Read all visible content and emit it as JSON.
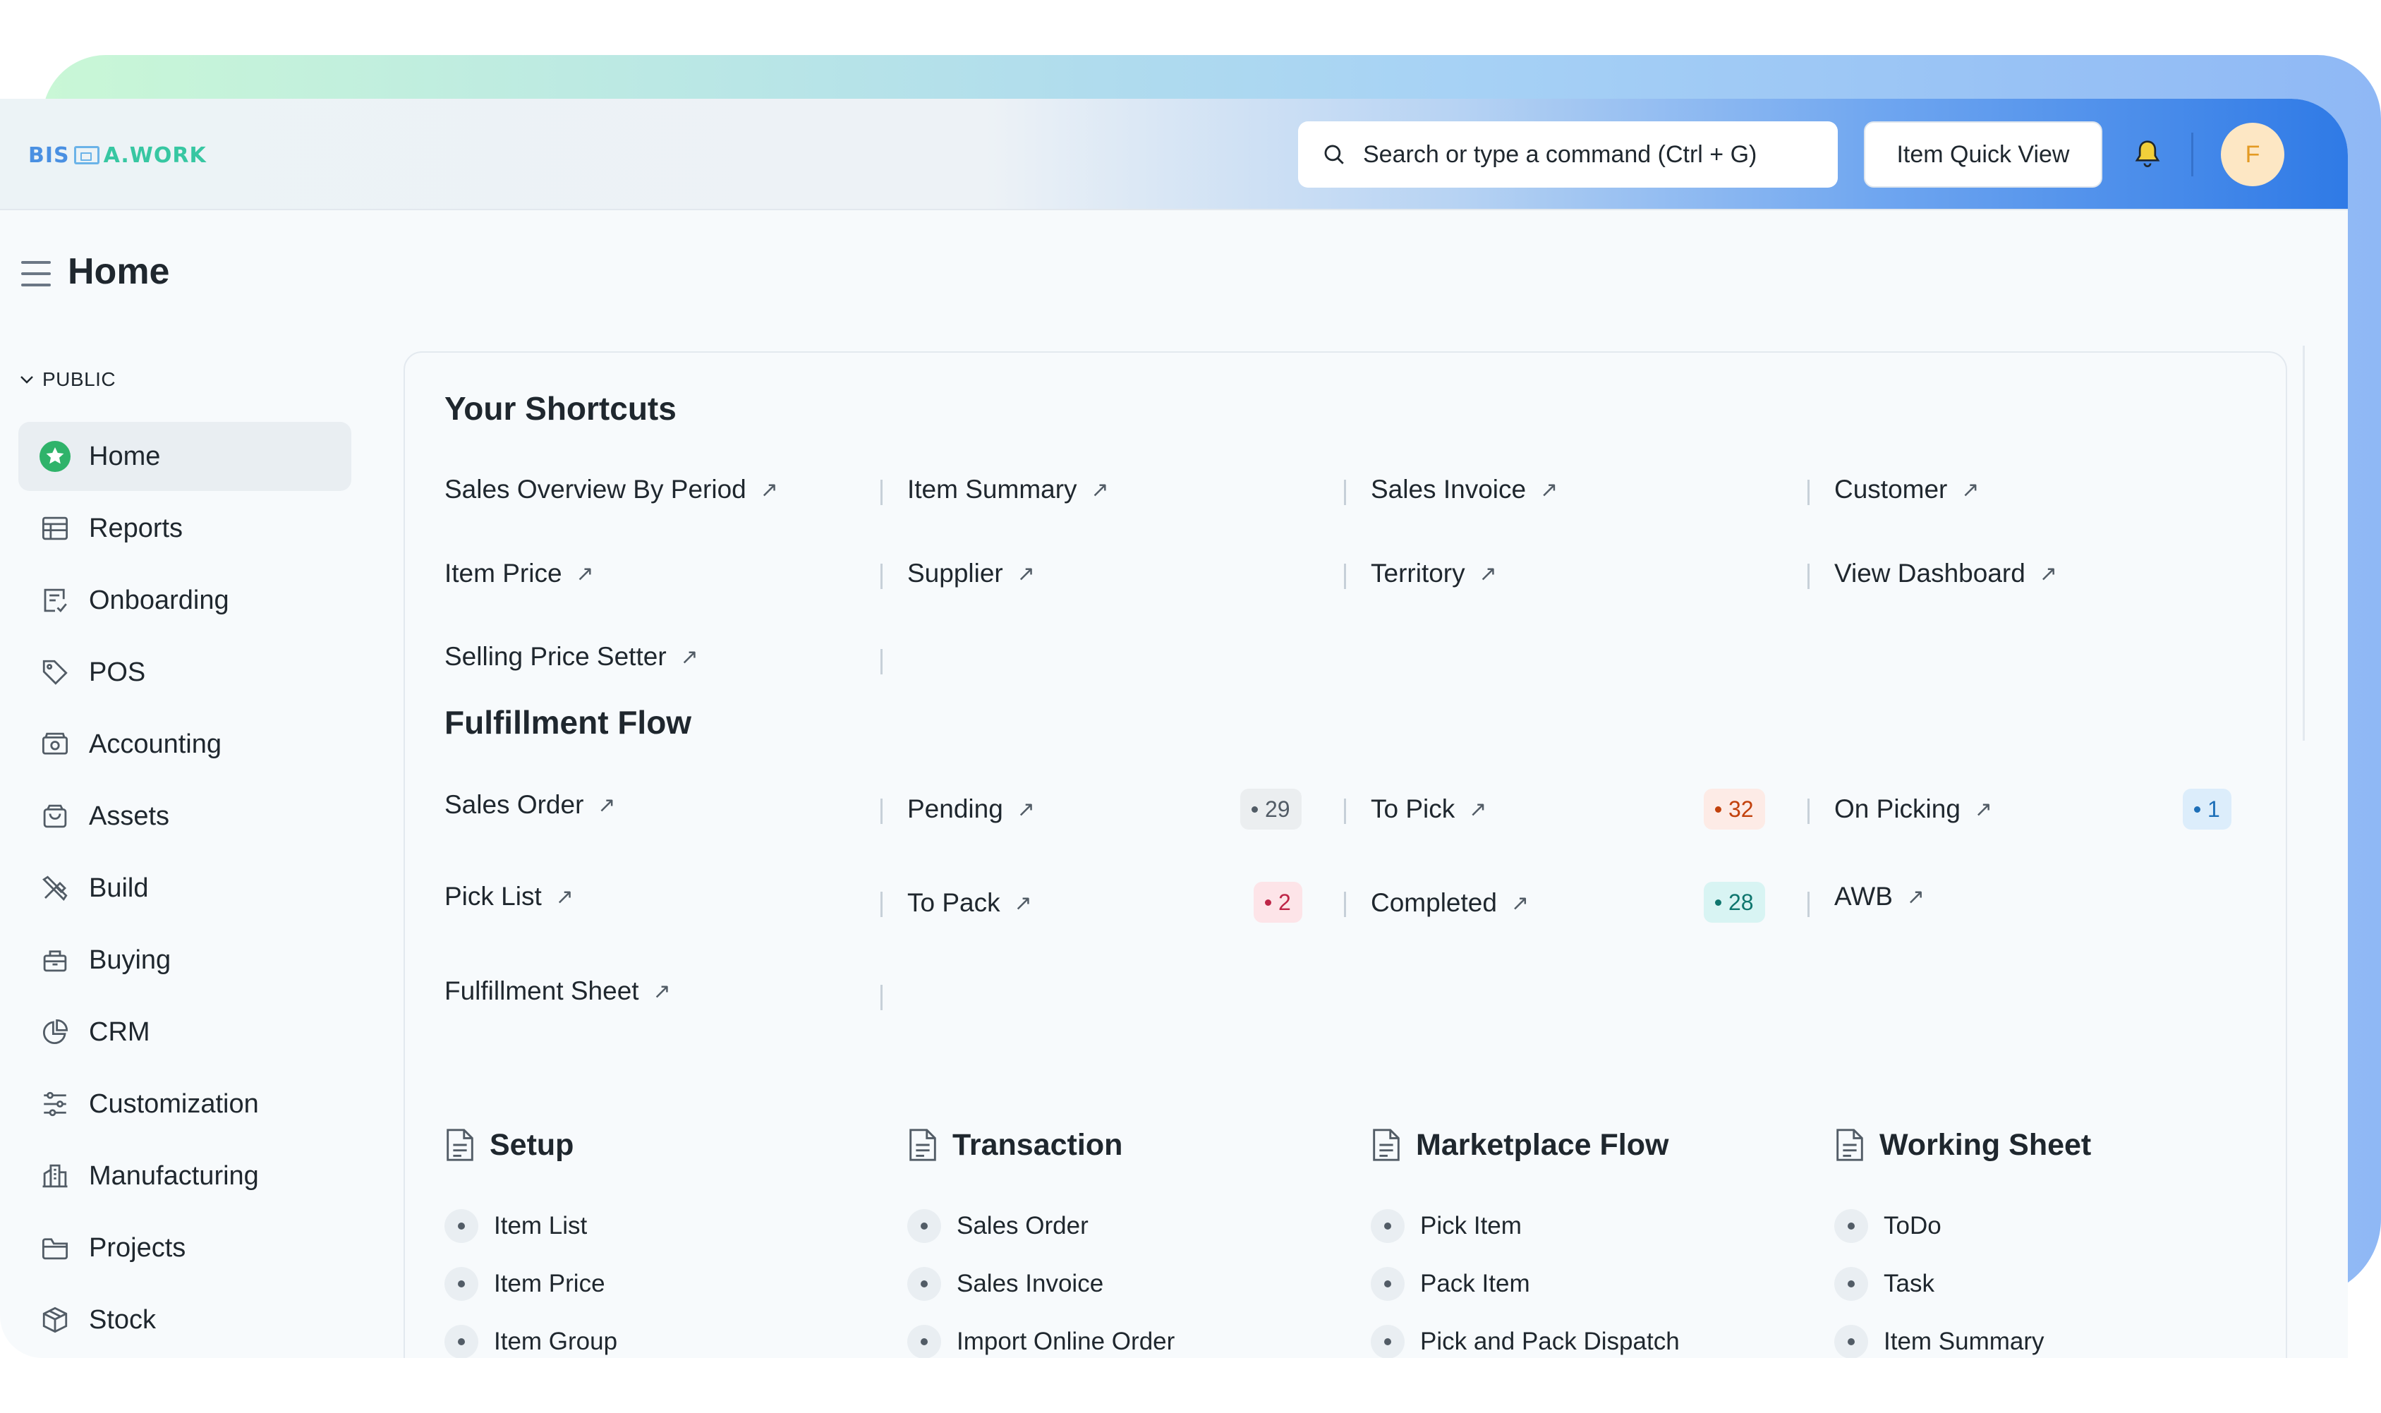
{
  "app": {
    "logo_part1": "BIS",
    "logo_part2": "A.WORK"
  },
  "navbar": {
    "search_placeholder": "Search or type a command (Ctrl + G)",
    "quick_view_label": "Item Quick View",
    "avatar_initial": "F"
  },
  "page": {
    "title": "Home"
  },
  "sidebar": {
    "section_label": "PUBLIC",
    "items": [
      {
        "label": "Home",
        "icon": "home-star-icon",
        "active": true
      },
      {
        "label": "Reports",
        "icon": "table-icon"
      },
      {
        "label": "Onboarding",
        "icon": "checklist-icon"
      },
      {
        "label": "POS",
        "icon": "tag-icon"
      },
      {
        "label": "Accounting",
        "icon": "money-icon"
      },
      {
        "label": "Assets",
        "icon": "bag-icon"
      },
      {
        "label": "Build",
        "icon": "tools-icon"
      },
      {
        "label": "Buying",
        "icon": "basket-icon"
      },
      {
        "label": "CRM",
        "icon": "pie-icon"
      },
      {
        "label": "Customization",
        "icon": "sliders-icon"
      },
      {
        "label": "Manufacturing",
        "icon": "factory-icon"
      },
      {
        "label": "Projects",
        "icon": "folder-icon"
      },
      {
        "label": "Stock",
        "icon": "box-icon"
      }
    ]
  },
  "shortcuts": {
    "title": "Your Shortcuts",
    "items": [
      "Sales Overview By Period",
      "Item Summary",
      "Sales Invoice",
      "Customer",
      "Item Price",
      "Supplier",
      "Territory",
      "View Dashboard",
      "Selling Price Setter"
    ]
  },
  "fulfillment": {
    "title": "Fulfillment Flow",
    "items": [
      {
        "label": "Sales Order"
      },
      {
        "label": "Pending",
        "count": "29"
      },
      {
        "label": "To Pick",
        "count": "32"
      },
      {
        "label": "On Picking",
        "count": "1"
      },
      {
        "label": "Pick List"
      },
      {
        "label": "To Pack",
        "count": "2"
      },
      {
        "label": "Completed",
        "count": "28"
      },
      {
        "label": "AWB"
      },
      {
        "label": "Fulfillment Sheet"
      }
    ],
    "badge_colors": {
      "gray": "#ebeef0",
      "orange": "#fdebe6",
      "blue": "#dcedfb",
      "red": "#fde4e8",
      "teal": "#d8f4f3"
    }
  },
  "cards": [
    {
      "title": "Setup",
      "links": [
        "Item List",
        "Item Price",
        "Item Group"
      ]
    },
    {
      "title": "Transaction",
      "links": [
        "Sales Order",
        "Sales Invoice",
        "Import Online Order"
      ]
    },
    {
      "title": "Marketplace Flow",
      "links": [
        "Pick Item",
        "Pack Item",
        "Pick and Pack Dispatch"
      ]
    },
    {
      "title": "Working Sheet",
      "links": [
        "ToDo",
        "Task",
        "Item Summary"
      ]
    }
  ]
}
